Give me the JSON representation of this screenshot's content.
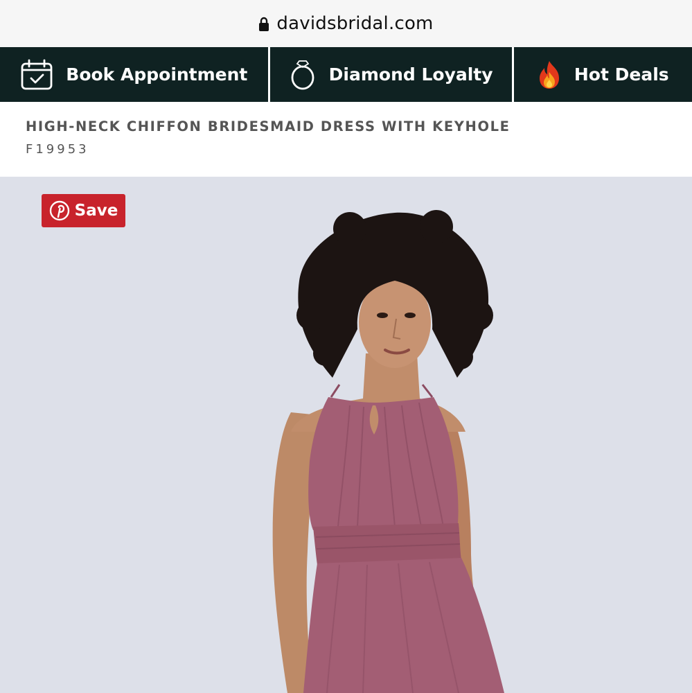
{
  "browser": {
    "url": "davidsbridal.com",
    "lock_icon": "lock-icon"
  },
  "nav": {
    "items": [
      {
        "label": "Book Appointment",
        "icon": "calendar-check-icon"
      },
      {
        "label": "Diamond Loyalty",
        "icon": "diamond-ring-icon"
      },
      {
        "label": "Hot Deals",
        "icon": "flame-icon"
      }
    ],
    "background": "#0f2222"
  },
  "product": {
    "title": "HIGH-NECK CHIFFON BRIDESMAID DRESS WITH KEYHOLE",
    "sku": "F19953"
  },
  "image": {
    "save_label": "Save",
    "save_icon": "pinterest-icon",
    "save_color": "#c8232c",
    "background": "#dde0e9",
    "dress_color": "#a35e74"
  }
}
